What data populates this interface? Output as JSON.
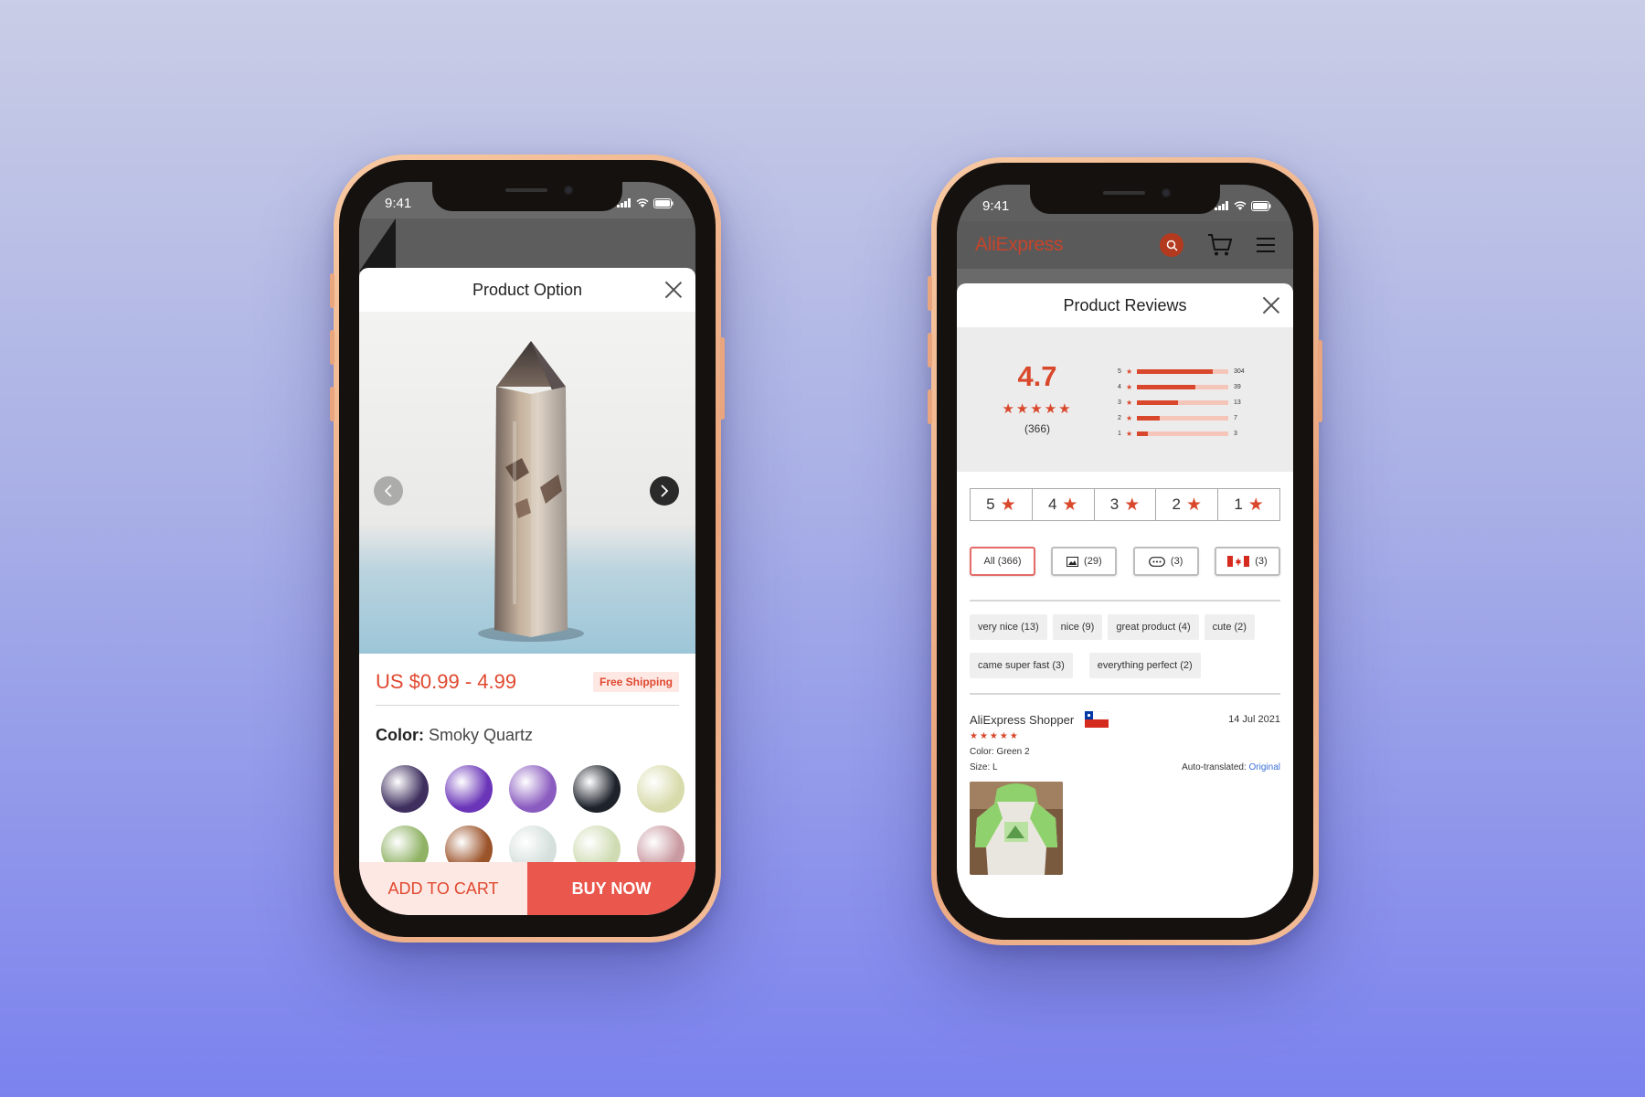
{
  "colors": {
    "accent": "#e0482f",
    "accent_light": "#fde8e4",
    "buy_button": "#e9574d",
    "link": "#3b6fd6"
  },
  "phone1": {
    "status_time": "9:41",
    "sheet_title": "Product Option",
    "price": "US $0.99 - 4.99",
    "shipping_badge": "Free Shipping",
    "color_label": "Color:",
    "color_value": "Smoky Quartz",
    "add_to_cart": "ADD TO CART",
    "buy_now": "BUY NOW",
    "swatch_colors": [
      "#3e2f5e",
      "#6a35b8",
      "#8b5cc0",
      "#1e232b",
      "#d8dcac",
      "#8fb264",
      "#9b532a",
      "#d5e0dd",
      "#cfdcb3",
      "#c99aa1"
    ]
  },
  "phone2": {
    "status_time": "9:41",
    "brand": "AliExpress",
    "sheet_title": "Product Reviews",
    "rating": "4.7",
    "rating_stars": "★★★★★",
    "rating_count": "(366)",
    "distribution": [
      {
        "stars": "5",
        "count": "304",
        "fraction": 0.83
      },
      {
        "stars": "4",
        "count": "39",
        "fraction": 0.64
      },
      {
        "stars": "3",
        "count": "13",
        "fraction": 0.45
      },
      {
        "stars": "2",
        "count": "7",
        "fraction": 0.25
      },
      {
        "stars": "1",
        "count": "3",
        "fraction": 0.12
      }
    ],
    "star_filters": [
      "5",
      "4",
      "3",
      "2",
      "1"
    ],
    "chips": {
      "all": "All (366)",
      "photos": "(29)",
      "comments": "(3)",
      "country": "(3)"
    },
    "tags": [
      "very nice (13)",
      "nice (9)",
      "great product (4)",
      "cute (2)",
      "came super fast (3)",
      "everything perfect (2)"
    ],
    "review": {
      "author": "AliExpress Shopper",
      "date": "14 Jul 2021",
      "stars": "★★★★★",
      "color": "Color: Green 2",
      "size": "Size: L",
      "translated_label": "Auto-translated:",
      "original_link": "Original"
    }
  }
}
